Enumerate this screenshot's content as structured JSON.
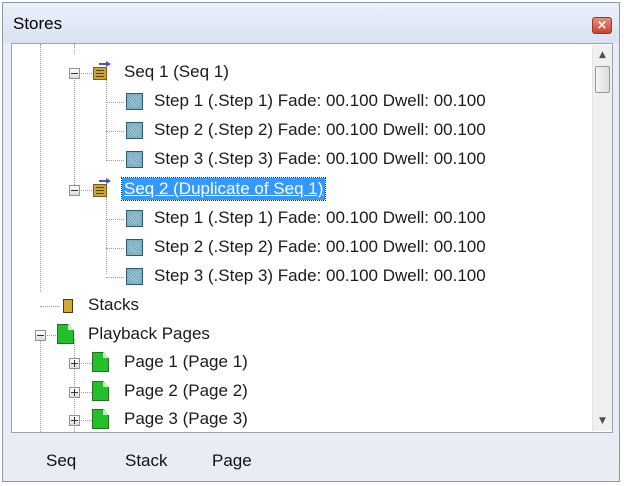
{
  "window": {
    "title": "Stores",
    "close_glyph": "×"
  },
  "tree": {
    "seq1": {
      "label": "Seq 1 (Seq 1)",
      "steps": [
        "Step 1 (.Step 1) Fade: 00.100 Dwell: 00.100",
        "Step 2 (.Step 2) Fade: 00.100 Dwell: 00.100",
        "Step 3 (.Step 3) Fade: 00.100 Dwell: 00.100"
      ]
    },
    "seq2": {
      "label": "Seq 2 (Duplicate of Seq 1)",
      "steps": [
        "Step 1 (.Step 1) Fade: 00.100 Dwell: 00.100",
        "Step 2 (.Step 2) Fade: 00.100 Dwell: 00.100",
        "Step 3 (.Step 3) Fade: 00.100 Dwell: 00.100"
      ]
    },
    "stacks": "Stacks",
    "playback_pages": "Playback Pages",
    "pages": [
      "Page 1 (Page 1)",
      "Page 2 (Page 2)",
      "Page 3 (Page 3)"
    ]
  },
  "scrollbar": {
    "up_glyph": "▲",
    "down_glyph": "▼"
  },
  "bottom_tabs": [
    "Seq",
    "Stack",
    "Page"
  ],
  "colors": {
    "selection": "#3399ff",
    "title_bar": "#dce6f2",
    "close_button": "#c8432f",
    "page_icon": "#22c02a",
    "step_icon": "#7fb0c4"
  }
}
